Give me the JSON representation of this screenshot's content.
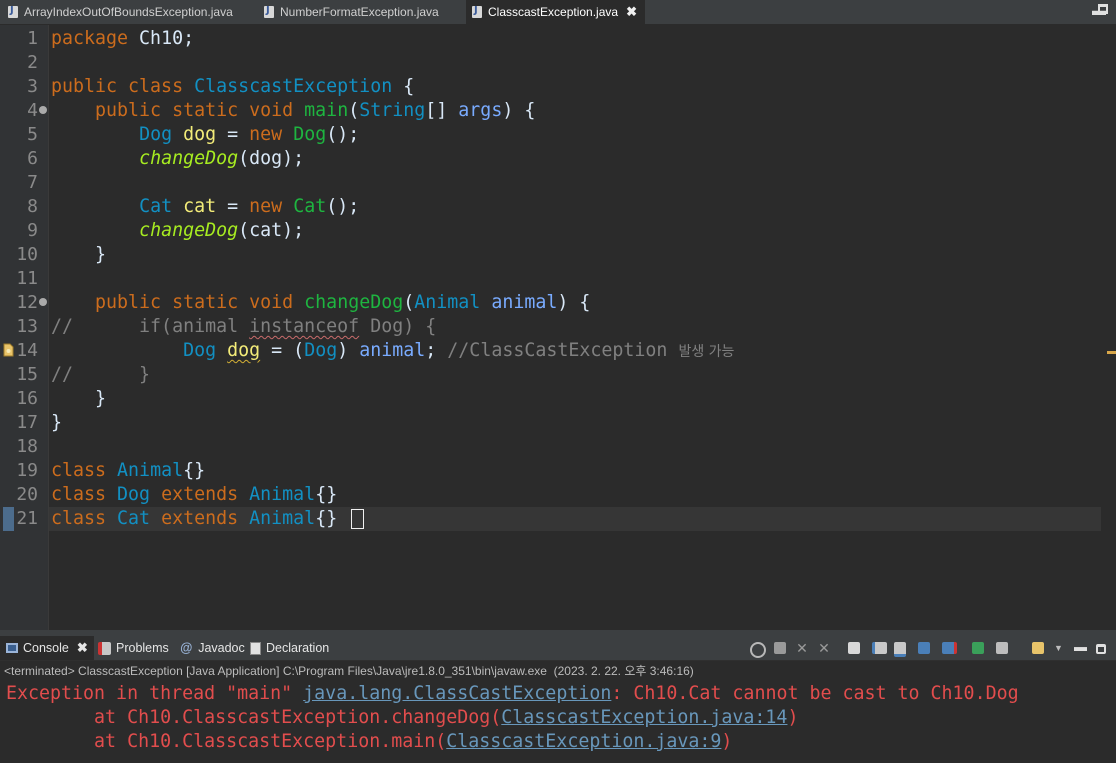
{
  "editor_tabs": [
    {
      "label": "ArrayIndexOutOfBoundsException.java",
      "active": false
    },
    {
      "label": "NumberFormatException.java",
      "active": false
    },
    {
      "label": "ClasscastException.java",
      "active": true
    }
  ],
  "line_numbers": [
    "1",
    "2",
    "3",
    "4",
    "5",
    "6",
    "7",
    "8",
    "9",
    "10",
    "11",
    "12",
    "13",
    "14",
    "15",
    "16",
    "17",
    "18",
    "19",
    "20",
    "21"
  ],
  "code": {
    "l1": {
      "kw": "package",
      "pkg": " Ch10;"
    },
    "l3": {
      "kw": "public class",
      "cls": "ClasscastException",
      "rest": " {"
    },
    "l4": {
      "kw": "public static void",
      "mth": "main",
      "p1": "(",
      "type": "String",
      "p2": "[] ",
      "param": "args",
      "p3": ") {"
    },
    "l5": {
      "cls": "Dog",
      "var": "dog",
      "eq": " = ",
      "kw": "new",
      "mth": "Dog",
      "rest": "();"
    },
    "l6": {
      "smth": "changeDog",
      "rest": "(dog);"
    },
    "l8": {
      "cls": "Cat",
      "var": "cat",
      "eq": " = ",
      "kw": "new",
      "mth": "Cat",
      "rest": "();"
    },
    "l9": {
      "smth": "changeDog",
      "rest": "(cat);"
    },
    "l10": {
      "rest": "}"
    },
    "l12": {
      "kw": "public static void",
      "mth": "changeDog",
      "p1": "(",
      "type": "Animal",
      "param": "animal",
      "p3": ") {"
    },
    "l13": {
      "cmt1": "//      if(animal ",
      "squig": "instanceof",
      "cmt2": " Dog) {"
    },
    "l14": {
      "cls": "Dog",
      "var": "dog",
      "eq": " = (",
      "cast": "Dog",
      "p": ") ",
      "param": "animal",
      "semi": "; ",
      "cmt": "//ClassCastException",
      "kor": "발생 가능"
    },
    "l15": {
      "cmt": "//      }"
    },
    "l16": {
      "rest": "}"
    },
    "l17": {
      "rest": "}"
    },
    "l19": {
      "kw": "class",
      "cls": "Animal",
      "rest": "{}"
    },
    "l20": {
      "kw": "class",
      "cls": "Dog",
      "kw2": "extends",
      "cls2": "Animal",
      "rest": "{}"
    },
    "l21": {
      "kw": "class",
      "cls": "Cat",
      "kw2": "extends",
      "cls2": "Animal",
      "rest1": "{",
      "rest2": "}"
    }
  },
  "console_tabs": [
    {
      "label": "Console",
      "active": true
    },
    {
      "label": "Problems",
      "active": false
    },
    {
      "label": "Javadoc",
      "active": false
    },
    {
      "label": "Declaration",
      "active": false
    }
  ],
  "console_status": "<terminated> ClasscastException [Java Application] C:\\Program Files\\Java\\jre1.8.0_351\\bin\\javaw.exe  (2023. 2. 22. 오후 3:46:16)",
  "console_output": {
    "line1_prefix": "Exception in thread \"main\" ",
    "line1_link": "java.lang.ClassCastException",
    "line1_suffix": ": Ch10.Cat cannot be cast to Ch10.Dog",
    "line2_prefix": "        at Ch10.ClasscastException.changeDog(",
    "line2_link": "ClasscastException.java:14",
    "line2_suffix": ")",
    "line3_prefix": "        at Ch10.ClasscastException.main(",
    "line3_link": "ClasscastException.java:9",
    "line3_suffix": ")"
  },
  "colors": {
    "keyword": "#cc6c1d",
    "class": "#1290c3",
    "method": "#1eb540",
    "static_method": "#a7ec21",
    "variable": "#f3ec79",
    "parameter": "#79abff",
    "comment": "#808080",
    "error": "#e24d4d",
    "link": "#6897bb"
  }
}
